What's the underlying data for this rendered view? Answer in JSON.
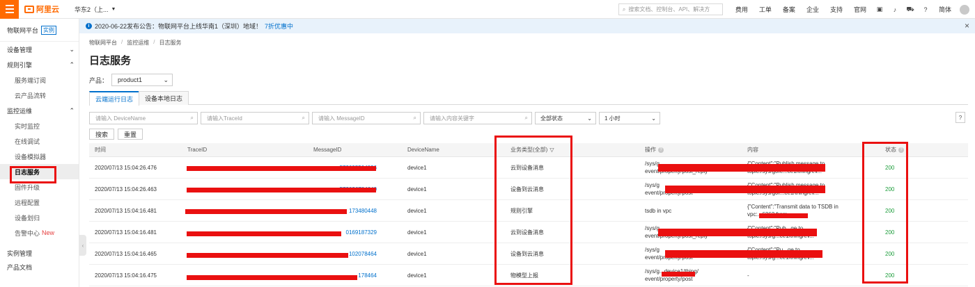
{
  "topbar": {
    "brand": "阿里云",
    "region": "华东2（上...",
    "search_placeholder": "搜索文档、控制台、API、解决方",
    "links": [
      "费用",
      "工单",
      "备案",
      "企业",
      "支持",
      "官网"
    ],
    "icons": [
      "terminal-icon",
      "bell-icon",
      "cart-icon",
      "help-icon"
    ],
    "lang": "简体"
  },
  "sidebar": {
    "title": "物联网平台",
    "tag": "实例",
    "groups": [
      {
        "label": "设备管理",
        "expanded": false
      },
      {
        "label": "规则引擎",
        "expanded": true,
        "items": [
          "服务端订阅",
          "云产品流转"
        ]
      },
      {
        "label": "监控运维",
        "expanded": true,
        "items": [
          "实时监控",
          "在线调试",
          "设备模拟器",
          "日志服务",
          "固件升级",
          "远程配置",
          "设备划归",
          "告警中心"
        ]
      }
    ],
    "new_badge": "New",
    "footer": [
      "实例管理",
      "产品文档"
    ]
  },
  "notice": {
    "text": "2020-06-22发布公告：物联网平台上线华南1（深圳）地域！",
    "link": "7折优惠中"
  },
  "breadcrumb": [
    "物联网平台",
    "监控运维",
    "日志服务"
  ],
  "page_title": "日志服务",
  "product": {
    "label": "产品：",
    "value": "product1"
  },
  "tabs": [
    "云端运行日志",
    "设备本地日志"
  ],
  "filters": {
    "device_name": "请输入 DeviceName",
    "trace_id": "请输入TraceId",
    "message_id": "请输入 MessageID",
    "keyword": "请输入内容关键字",
    "status": "全部状态",
    "time": "1 小时"
  },
  "buttons": {
    "search": "搜索",
    "reset": "重置",
    "help": "?"
  },
  "table": {
    "headers": [
      "时间",
      "TraceID",
      "MessageID",
      "DeviceName",
      "业务类型(全部)",
      "操作",
      "内容",
      "状态"
    ],
    "rows": [
      {
        "time": "2020/07/13 15:04:26.476",
        "msg": "572095504896",
        "device": "device1",
        "type": "云到设备消息",
        "op": [
          "/sys/g",
          "event/property/post_reply"
        ],
        "content": [
          "{\"Content\":\"Publish message to",
          "topic:/sys/g0fe...ce1/thing/ev..."
        ],
        "status": "200"
      },
      {
        "time": "2020/07/13 15:04:26.463",
        "msg": "572036784640",
        "device": "device1",
        "type": "设备到云消息",
        "op": [
          "/sys/g",
          "event/property/post"
        ],
        "content": [
          "{\"Content\":\"Publish message to",
          "topic:/sys/g0f...ce1/thing/ev..."
        ],
        "status": "200"
      },
      {
        "time": "2020/07/13 15:04:16.481",
        "msg": "173480448",
        "device": "device1",
        "type": "规则引擎",
        "op": [
          "tsdb in vpc"
        ],
        "content": [
          "{\"Content\":\"Transmit data to TSDB in",
          "vpc:...6363,from..."
        ],
        "status": "200"
      },
      {
        "time": "2020/07/13 15:04:16.481",
        "msg": "0169187329",
        "device": "device1",
        "type": "云到设备消息",
        "op": [
          "/sys/g",
          "event/property/post_reply"
        ],
        "content": [
          "{\"Content\":\"Pub...ge to",
          "topic:/sys/g...ce1/thing/ev..."
        ],
        "status": "200"
      },
      {
        "time": "2020/07/13 15:04:16.465",
        "msg": "102078464",
        "device": "device1",
        "type": "设备到云消息",
        "op": [
          "/sys/g",
          "event/property/post"
        ],
        "content": [
          "{\"Content\":\"Pu...ge to",
          "topic:/sys/g...ce1/thing/ev..."
        ],
        "status": "200"
      },
      {
        "time": "2020/07/13 15:04:16.475",
        "msg": "178464",
        "device": "device1",
        "type": "物模型上报",
        "op": [
          "/sys/g...device1/thing/",
          "event/property/post"
        ],
        "content": [
          "-"
        ],
        "status": "200"
      }
    ]
  },
  "colors": {
    "brand": "#ff6a00",
    "link": "#0070cc",
    "ok": "#1a9c39",
    "annotation": "#ea1010"
  }
}
